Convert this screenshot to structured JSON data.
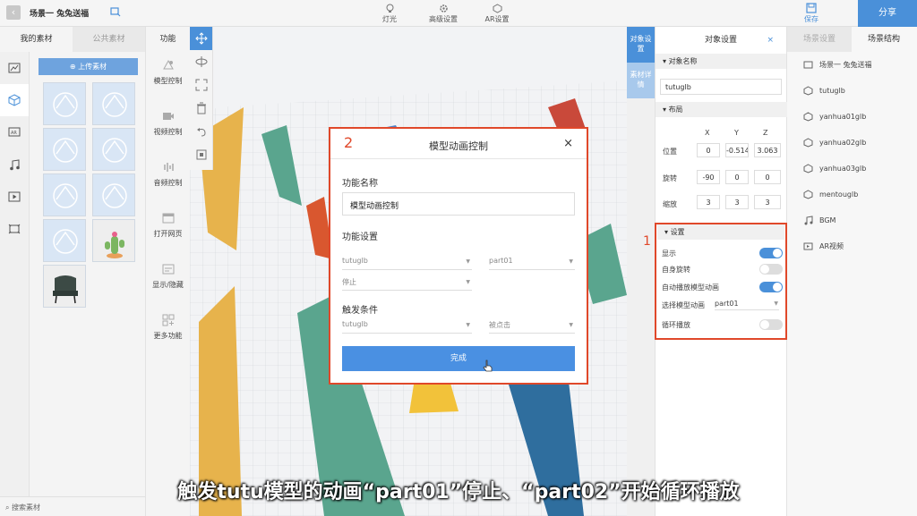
{
  "topbar": {
    "scene_title": "场景一 兔兔送福",
    "tools": [
      {
        "label": "灯光",
        "icon": "bulb-icon"
      },
      {
        "label": "高级设置",
        "icon": "gear-icon"
      },
      {
        "label": "AR设置",
        "icon": "ar-icon"
      }
    ],
    "save_label": "保存",
    "share_label": "分享"
  },
  "left": {
    "tabs": [
      "我的素材",
      "公共素材"
    ],
    "upload_label": "上传素材",
    "search_placeholder": "搜索素材",
    "func_header": "功能",
    "func_items": [
      {
        "label": "模型控制",
        "icon": "model-control-icon"
      },
      {
        "label": "视频控制",
        "icon": "video-control-icon"
      },
      {
        "label": "音频控制",
        "icon": "audio-control-icon"
      },
      {
        "label": "打开网页",
        "icon": "webpage-icon"
      },
      {
        "label": "显示/隐藏",
        "icon": "show-hide-icon"
      },
      {
        "label": "更多功能",
        "icon": "more-functions-icon"
      }
    ]
  },
  "sidetabs": [
    "对象设置",
    "素材详情"
  ],
  "object_panel": {
    "title": "对象设置",
    "name_section": "对象名称",
    "name_value": "tutuglb",
    "layout_section": "布局",
    "axes": [
      "X",
      "Y",
      "Z"
    ],
    "position_label": "位置",
    "position": [
      "0",
      "-0.514",
      "3.063"
    ],
    "rotation_label": "旋转",
    "rotation": [
      "-90",
      "0",
      "0"
    ],
    "scale_label": "缩放",
    "scale": [
      "3",
      "3",
      "3"
    ],
    "settings_section": "设置",
    "show_label": "显示",
    "show_on": true,
    "self_rotate_label": "自身旋转",
    "self_rotate_on": false,
    "autoplay_label": "自动播放模型动画",
    "autoplay_on": true,
    "choose_anim_label": "选择模型动画",
    "choose_anim_value": "part01",
    "loop_label": "循环播放",
    "loop_on": false
  },
  "scene_panel": {
    "tabs": [
      "场景设置",
      "场景结构"
    ],
    "items": [
      "场景一 兔兔送福",
      "tutuglb",
      "yanhua01glb",
      "yanhua02glb",
      "yanhua03glb",
      "mentouglb",
      "BGM",
      "AR视频"
    ]
  },
  "dialog": {
    "number": "2",
    "title": "模型动画控制",
    "close": "×",
    "func_name_label": "功能名称",
    "func_name_value": "模型动画控制",
    "func_settings_label": "功能设置",
    "target_value": "tutuglb",
    "anim_value": "part01",
    "action_value": "停止",
    "trigger_label": "触发条件",
    "trigger_target": "tutuglb",
    "trigger_event": "被点击",
    "done_label": "完成"
  },
  "annotation_1": "1",
  "subtitle": "触发tutu模型的动画“part01”停止、“part02”开始循环播放",
  "colors": {
    "accent": "#4a90d9",
    "highlight": "#e0482a"
  }
}
